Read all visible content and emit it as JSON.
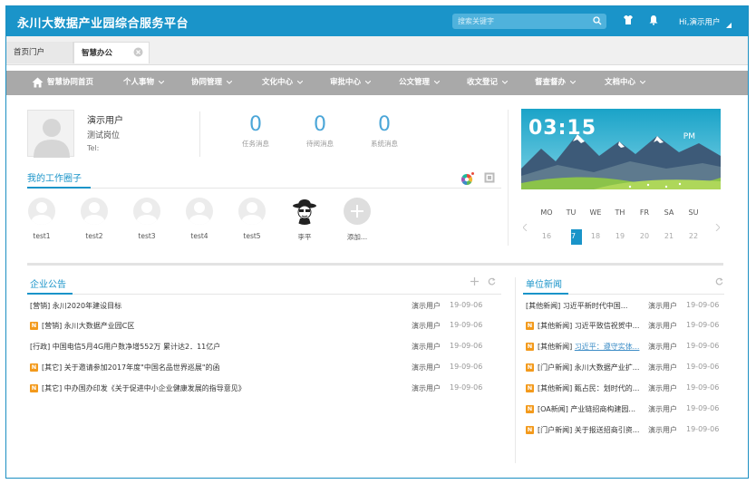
{
  "header": {
    "title": "永川大数据产业园综合服务平台",
    "search_placeholder": "搜索关键字",
    "greeting": "Hi,演示用户"
  },
  "tabs": [
    {
      "label": "首页门户"
    },
    {
      "label": "智慧办公"
    }
  ],
  "nav": {
    "items": [
      {
        "label": "智慧协同首页"
      },
      {
        "label": "个人事物"
      },
      {
        "label": "协同管理"
      },
      {
        "label": "文化中心"
      },
      {
        "label": "审批中心"
      },
      {
        "label": "公文管理"
      },
      {
        "label": "收文登记"
      },
      {
        "label": "督查督办"
      },
      {
        "label": "文档中心"
      }
    ]
  },
  "profile": {
    "name": "演示用户",
    "role": "测试岗位",
    "tel": "Tel:"
  },
  "stats": [
    {
      "value": "0",
      "label": "任务消息"
    },
    {
      "value": "0",
      "label": "待阅消息"
    },
    {
      "value": "0",
      "label": "系统消息"
    }
  ],
  "work_circle": {
    "title": "我的工作圈子",
    "members": [
      {
        "label": "test1"
      },
      {
        "label": "test2"
      },
      {
        "label": "test3"
      },
      {
        "label": "test4"
      },
      {
        "label": "test5"
      },
      {
        "label": "李平"
      }
    ],
    "add_label": "添加..."
  },
  "clock": {
    "time": "03:15",
    "ampm": "PM"
  },
  "calendar": {
    "days": [
      "MO",
      "TU",
      "WE",
      "TH",
      "FR",
      "SA",
      "SU"
    ],
    "dates": [
      "16",
      "17",
      "18",
      "19",
      "20",
      "21",
      "22"
    ],
    "today": "17"
  },
  "announcements": {
    "title": "企业公告",
    "rows": [
      {
        "text": "[营销] 永川2020年建设目标",
        "author": "演示用户",
        "date": "19-09-06",
        "is_new": false
      },
      {
        "text": "[营销] 永川大数据产业园C区",
        "author": "演示用户",
        "date": "19-09-06",
        "is_new": true
      },
      {
        "text": "[行政] 中国电信5月4G用户数净增552万 累计达2．11亿户",
        "author": "演示用户",
        "date": "19-09-06",
        "is_new": false
      },
      {
        "text": "[其它] 关于邀请参加2017年度\"中国名品世界巡展\"的函",
        "author": "演示用户",
        "date": "19-09-06",
        "is_new": true
      },
      {
        "text": "[其它] 中办国办印发《关于促进中小企业健康发展的指导意见》",
        "author": "演示用户",
        "date": "19-09-06",
        "is_new": true
      }
    ]
  },
  "news": {
    "title": "单位新闻",
    "rows": [
      {
        "text": "[其他新闻] 习近平新时代中国...",
        "author": "演示用户",
        "date": "19-09-06",
        "is_new": false,
        "link": false
      },
      {
        "text": "[其他新闻] 习近平致信祝贺中...",
        "author": "演示用户",
        "date": "19-09-06",
        "is_new": true,
        "link": false
      },
      {
        "text_prefix": "[其他新闻] ",
        "link_text": "习近平：遵守实体...",
        "author": "演示用户",
        "date": "19-09-06",
        "is_new": true,
        "link": true
      },
      {
        "text": "[门户新闻] 永川大数据产业扩...",
        "author": "演示用户",
        "date": "19-09-06",
        "is_new": true,
        "link": false
      },
      {
        "text": "[其他新闻] 甄占民：划时代的...",
        "author": "演示用户",
        "date": "19-09-06",
        "is_new": true,
        "link": false
      },
      {
        "text": "[OA新闻] 产业链招商构建园...",
        "author": "演示用户",
        "date": "19-09-06",
        "is_new": true,
        "link": false
      },
      {
        "text": "[门户新闻] 关于报送招商引资...",
        "author": "演示用户",
        "date": "19-09-06",
        "is_new": true,
        "link": false
      }
    ]
  },
  "badge": {
    "new": "N"
  },
  "colors": {
    "header_bg": "#1a94c9",
    "nav_bg": "#a9a9a9",
    "accent": "#1a94c9",
    "stat_blue": "#4ba6d8",
    "new_badge": "#f39a1c"
  }
}
